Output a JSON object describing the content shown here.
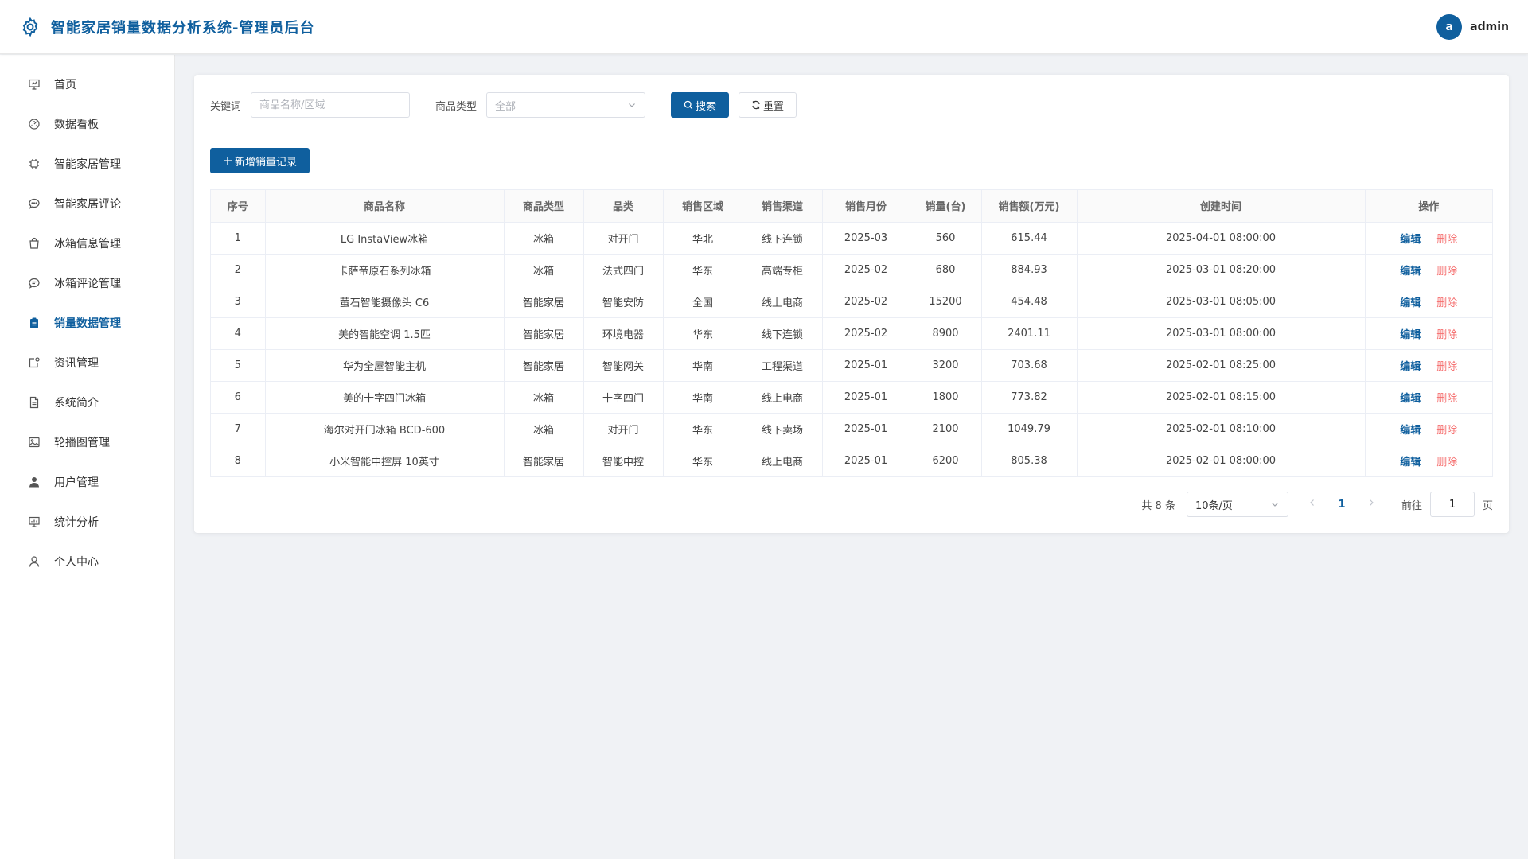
{
  "header": {
    "title": "智能家居销量数据分析系统-管理员后台",
    "avatar_letter": "a",
    "username": "admin",
    "accent": "#0f5f9e"
  },
  "sidebar": {
    "items": [
      {
        "label": "首页",
        "icon": "presentation-icon"
      },
      {
        "label": "数据看板",
        "icon": "dashboard-gauge-icon"
      },
      {
        "label": "智能家居管理",
        "icon": "chip-icon"
      },
      {
        "label": "智能家居评论",
        "icon": "comment-icon"
      },
      {
        "label": "冰箱信息管理",
        "icon": "shopping-bag-icon"
      },
      {
        "label": "冰箱评论管理",
        "icon": "chat-icon"
      },
      {
        "label": "销量数据管理",
        "icon": "clipboard-icon",
        "active": true
      },
      {
        "label": "资讯管理",
        "icon": "news-icon"
      },
      {
        "label": "系统简介",
        "icon": "document-icon"
      },
      {
        "label": "轮播图管理",
        "icon": "picture-icon"
      },
      {
        "label": "用户管理",
        "icon": "user-filled-icon"
      },
      {
        "label": "统计分析",
        "icon": "chart-board-icon"
      },
      {
        "label": "个人中心",
        "icon": "user-outline-icon"
      }
    ]
  },
  "filters": {
    "keyword_label": "关键词",
    "keyword_placeholder": "商品名称/区域",
    "keyword_value": "",
    "type_label": "商品类型",
    "type_selected": "全部",
    "search_button": "搜索",
    "reset_button": "重置"
  },
  "actions": {
    "add_button": "新增销量记录"
  },
  "table": {
    "columns": [
      "序号",
      "商品名称",
      "商品类型",
      "品类",
      "销售区域",
      "销售渠道",
      "销售月份",
      "销量(台)",
      "销售额(万元)",
      "创建时间",
      "操作"
    ],
    "rows": [
      {
        "index": "1",
        "name": "LG InstaView冰箱",
        "type": "冰箱",
        "category": "对开门",
        "region": "华北",
        "channel": "线下连锁",
        "month": "2025-03",
        "units": "560",
        "amount": "615.44",
        "created": "2025-04-01 08:00:00"
      },
      {
        "index": "2",
        "name": "卡萨帝原石系列冰箱",
        "type": "冰箱",
        "category": "法式四门",
        "region": "华东",
        "channel": "高端专柜",
        "month": "2025-02",
        "units": "680",
        "amount": "884.93",
        "created": "2025-03-01 08:20:00"
      },
      {
        "index": "3",
        "name": "萤石智能摄像头 C6",
        "type": "智能家居",
        "category": "智能安防",
        "region": "全国",
        "channel": "线上电商",
        "month": "2025-02",
        "units": "15200",
        "amount": "454.48",
        "created": "2025-03-01 08:05:00"
      },
      {
        "index": "4",
        "name": "美的智能空调 1.5匹",
        "type": "智能家居",
        "category": "环境电器",
        "region": "华东",
        "channel": "线下连锁",
        "month": "2025-02",
        "units": "8900",
        "amount": "2401.11",
        "created": "2025-03-01 08:00:00"
      },
      {
        "index": "5",
        "name": "华为全屋智能主机",
        "type": "智能家居",
        "category": "智能网关",
        "region": "华南",
        "channel": "工程渠道",
        "month": "2025-01",
        "units": "3200",
        "amount": "703.68",
        "created": "2025-02-01 08:25:00"
      },
      {
        "index": "6",
        "name": "美的十字四门冰箱",
        "type": "冰箱",
        "category": "十字四门",
        "region": "华南",
        "channel": "线上电商",
        "month": "2025-01",
        "units": "1800",
        "amount": "773.82",
        "created": "2025-02-01 08:15:00"
      },
      {
        "index": "7",
        "name": "海尔对开门冰箱 BCD-600",
        "type": "冰箱",
        "category": "对开门",
        "region": "华东",
        "channel": "线下卖场",
        "month": "2025-01",
        "units": "2100",
        "amount": "1049.79",
        "created": "2025-02-01 08:10:00"
      },
      {
        "index": "8",
        "name": "小米智能中控屏 10英寸",
        "type": "智能家居",
        "category": "智能中控",
        "region": "华东",
        "channel": "线上电商",
        "month": "2025-01",
        "units": "6200",
        "amount": "805.38",
        "created": "2025-02-01 08:00:00"
      }
    ],
    "edit_label": "编辑",
    "delete_label": "删除",
    "delete_color": "#f56c6c"
  },
  "pagination": {
    "total_text": "共 8 条",
    "page_size": "10条/页",
    "current_page": "1",
    "goto_label": "前往",
    "goto_value": "1",
    "goto_suffix": "页"
  }
}
